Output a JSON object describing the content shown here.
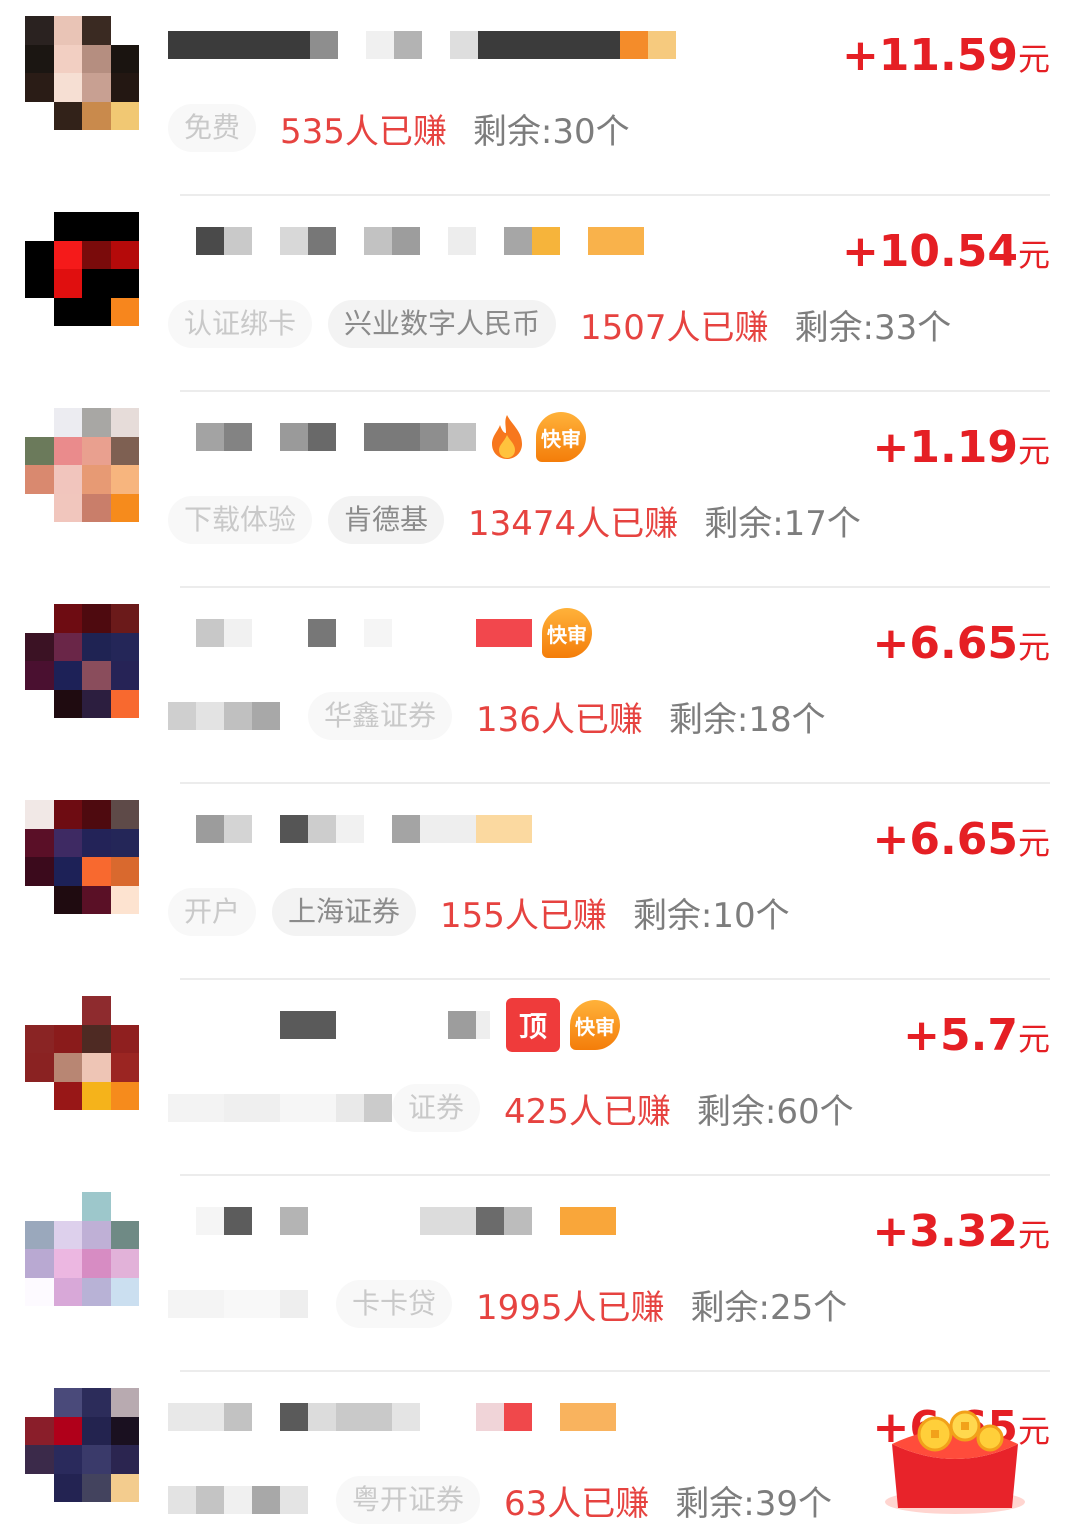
{
  "colors": {
    "accent_red": "#e51f24",
    "earned_red": "#e64340",
    "muted_gray": "#7d7d7d"
  },
  "tasks": [
    {
      "reward": "+11.59",
      "unit": "元",
      "tags": [
        "免费"
      ],
      "earned": "535人已赚",
      "left": "剩余:30个",
      "badges": []
    },
    {
      "reward": "+10.54",
      "unit": "元",
      "tags": [
        "认证绑卡",
        "兴业数字人民币"
      ],
      "earned": "1507人已赚",
      "left": "剩余:33个",
      "badges": []
    },
    {
      "reward": "+1.19",
      "unit": "元",
      "tags": [
        "下载体验",
        "肯德基"
      ],
      "earned": "13474人已赚",
      "left": "剩余:17个",
      "badges": [
        "fire",
        "快审"
      ]
    },
    {
      "reward": "+6.65",
      "unit": "元",
      "tags": [
        "华鑫证券"
      ],
      "earned": "136人已赚",
      "left": "剩余:18个",
      "badges": [
        "快审"
      ]
    },
    {
      "reward": "+6.65",
      "unit": "元",
      "tags": [
        "开户",
        "上海证券"
      ],
      "earned": "155人已赚",
      "left": "剩余:10个",
      "badges": []
    },
    {
      "reward": "+5.7",
      "unit": "元",
      "tags": [
        "证券"
      ],
      "earned": "425人已赚",
      "left": "剩余:60个",
      "badges": [
        "顶",
        "快审"
      ]
    },
    {
      "reward": "+3.32",
      "unit": "元",
      "tags": [
        "卡卡贷"
      ],
      "earned": "1995人已赚",
      "left": "剩余:25个",
      "badges": []
    },
    {
      "reward": "+6.65",
      "unit": "元",
      "tags": [
        "粤开证券"
      ],
      "earned": "63人已赚",
      "left": "剩余:39个",
      "badges": []
    }
  ],
  "badge_labels": {
    "quick_review": "快审",
    "pinned": "顶"
  },
  "icons": [
    "fire-icon",
    "quick-review-badge",
    "pinned-badge",
    "red-packet-icon"
  ]
}
